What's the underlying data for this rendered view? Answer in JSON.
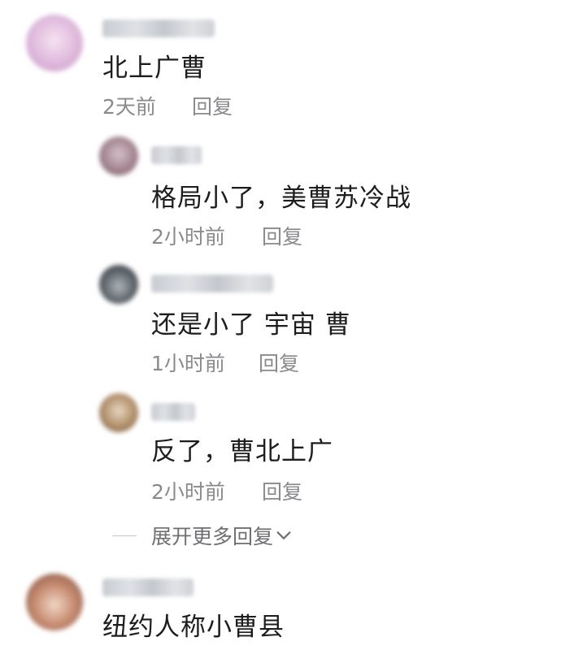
{
  "colors": {
    "text": "#1d1d1f",
    "meta": "#8a8a8e",
    "expand": "#6f6f73"
  },
  "comments": [
    {
      "text": "北上广曹",
      "time": "2天前",
      "reply_label": "回复",
      "avatar_colors": [
        "#e8c7e3",
        "#b98ab5"
      ]
    },
    {
      "text": "格局小了，美曹苏冷战",
      "time": "2小时前",
      "reply_label": "回复",
      "avatar_colors": [
        "#8a6f7a",
        "#c9b3bb"
      ]
    },
    {
      "text": "还是小了 宇宙 曹",
      "time": "1小时前",
      "reply_label": "回复",
      "avatar_colors": [
        "#3c4248",
        "#9aa1a8"
      ]
    },
    {
      "text": "反了，曹北上广",
      "time": "2小时前",
      "reply_label": "回复",
      "avatar_colors": [
        "#9a7a5a",
        "#d8c2a6"
      ]
    },
    {
      "text": "纽约人称小曹县",
      "avatar_colors": [
        "#7a4a3a",
        "#e2b8a0"
      ]
    }
  ],
  "expand_more": {
    "label": "展开更多回复",
    "icon": "chevron-down-icon"
  }
}
